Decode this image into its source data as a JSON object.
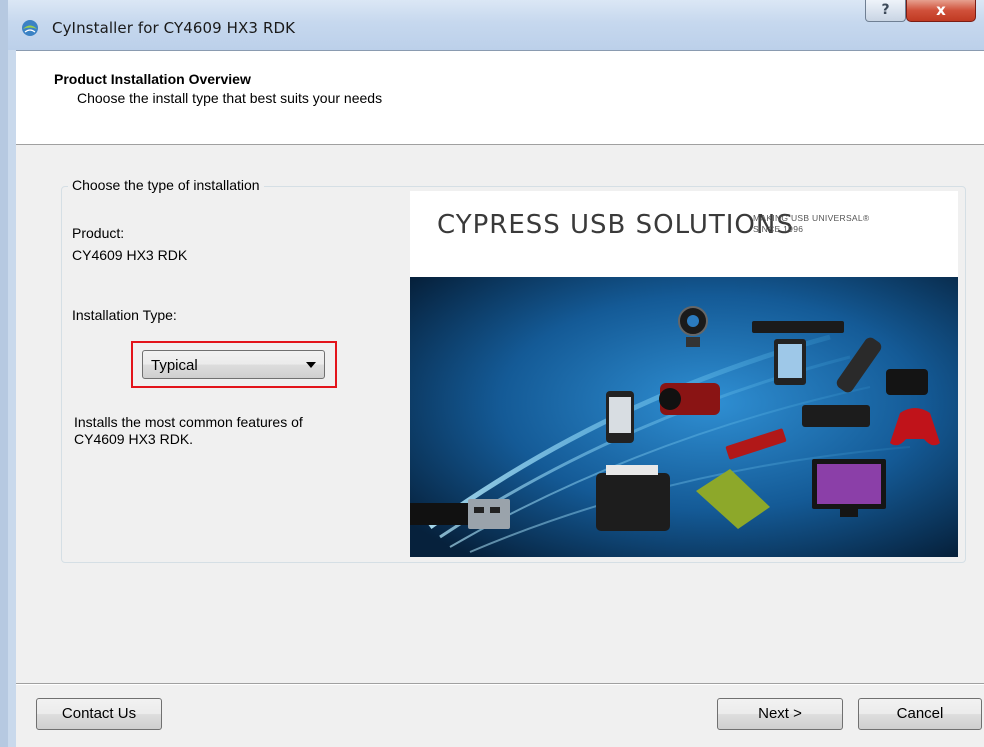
{
  "window": {
    "title": "CyInstaller for CY4609 HX3 RDK",
    "help_label": "?",
    "close_label": "x"
  },
  "header": {
    "title": "Product Installation Overview",
    "subtitle": "Choose the install type that best suits your needs"
  },
  "group": {
    "legend": "Choose the type of installation",
    "product_label": "Product:",
    "product_value": "CY4609 HX3 RDK",
    "install_type_label": "Installation Type:",
    "install_type_selected": "Typical",
    "description_line1": "Installs the most common features of",
    "description_line2": "CY4609 HX3 RDK."
  },
  "banner": {
    "brand": "CYPRESS USB SOLUTIONS",
    "tagline1": "MAKING USB UNIVERSAL®",
    "tagline2": "SINCE 1996",
    "art_colors": [
      "#0a2a4a",
      "#1f6aa8",
      "#7fd0f5"
    ]
  },
  "footer": {
    "contact_label": "Contact Us",
    "next_label": "Next >",
    "cancel_label": "Cancel"
  }
}
